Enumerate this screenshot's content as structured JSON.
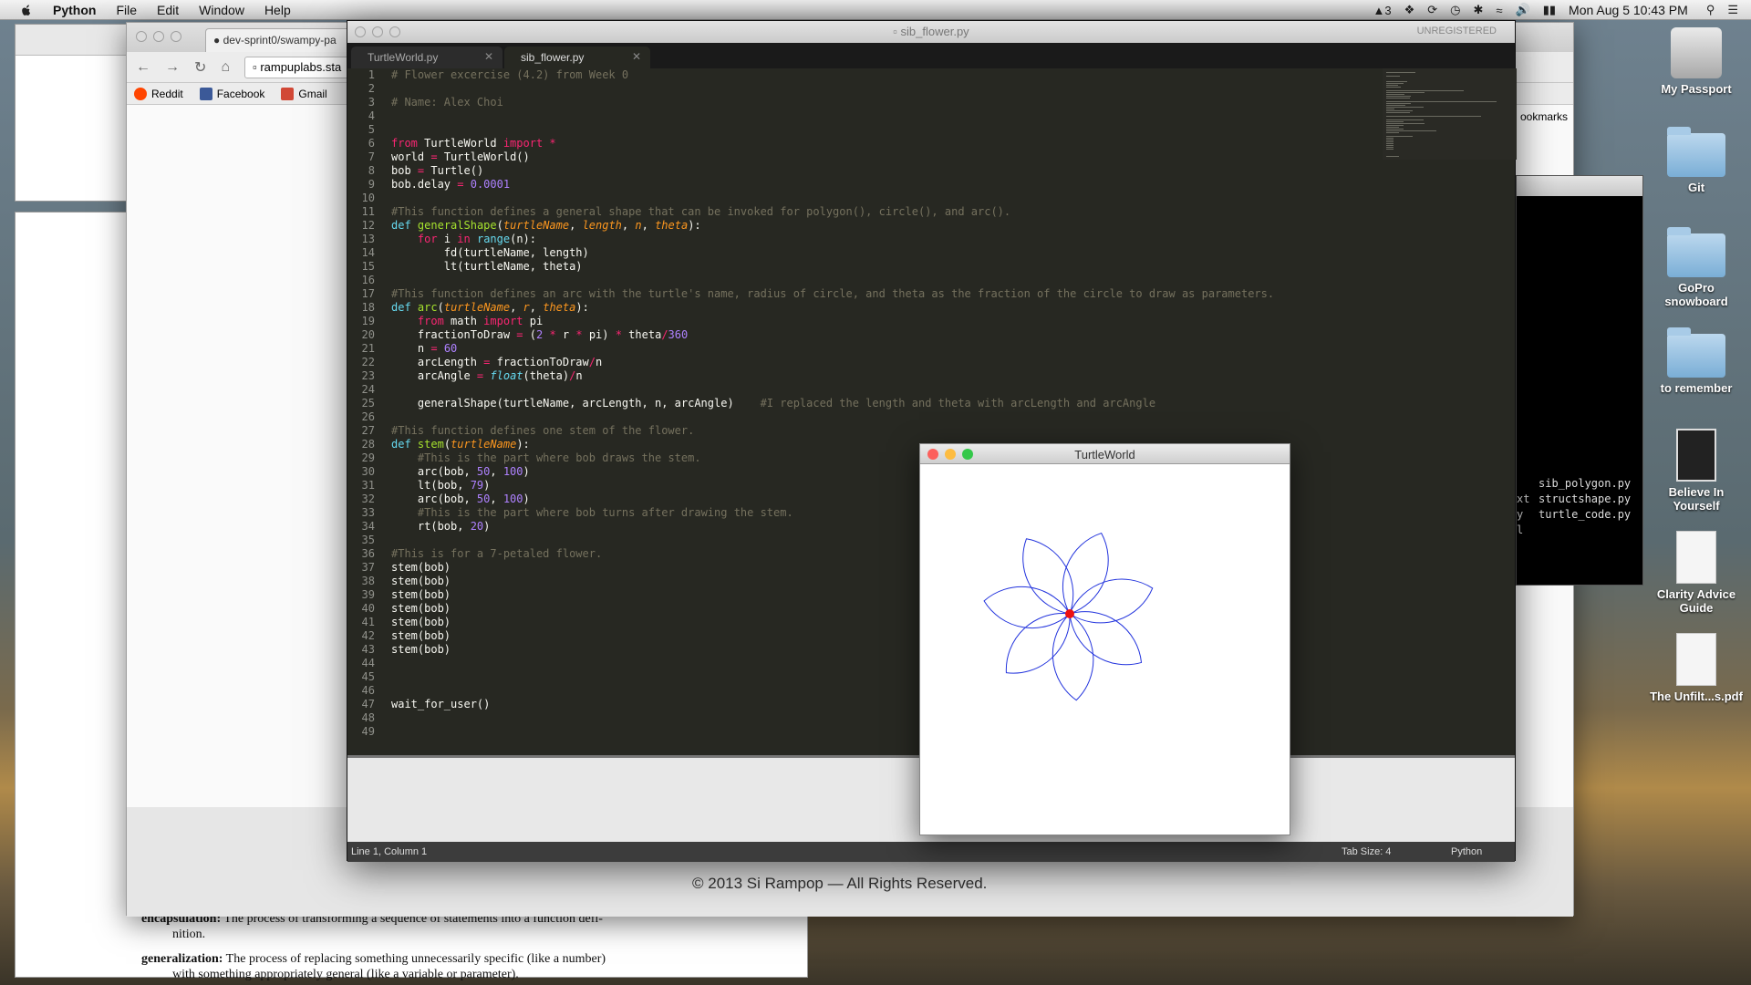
{
  "menubar": {
    "app_name": "Python",
    "items": [
      "File",
      "Edit",
      "Window",
      "Help"
    ],
    "status": {
      "notifications": "3",
      "clock": "Mon Aug 5  10:43 PM"
    }
  },
  "browser": {
    "tab_label": "dev-sprint0/swampy-pa",
    "url": "rampuplabs.sta",
    "bookmarks": [
      "Reddit",
      "Facebook",
      "Gmail"
    ],
    "bookmarks_overflow": "ookmarks",
    "copyright": "© 2013 Si Rampop — All Rights Reserved."
  },
  "pdf": {
    "glossary": [
      {
        "term": "encapsulation:",
        "text": "The process of transforming a sequence of statements into a function defi-",
        "cont": "nition."
      },
      {
        "term": "generalization:",
        "text": "The process of replacing something unnecessarily specific (like a number)",
        "cont": "with something appropriately general (like a variable or parameter)."
      }
    ]
  },
  "editor": {
    "window_title": "sib_flower.py",
    "registration": "UNREGISTERED",
    "tabs": [
      {
        "label": "TurtleWorld.py",
        "active": false
      },
      {
        "label": "sib_flower.py",
        "active": true
      }
    ],
    "status": {
      "position": "Line 1, Column 1",
      "tab_size": "Tab Size: 4",
      "syntax": "Python"
    },
    "lines": [
      [
        [
          "cm",
          "# Flower excercise (4.2) from Week 0"
        ]
      ],
      [],
      [
        [
          "cm",
          "# Name: Alex Choi"
        ]
      ],
      [],
      [],
      [
        [
          "kw",
          "from"
        ],
        [
          "t",
          " TurtleWorld "
        ],
        [
          "kw",
          "import"
        ],
        [
          "t",
          " "
        ],
        [
          "kw",
          "*"
        ]
      ],
      [
        [
          "t",
          "world "
        ],
        [
          "kw",
          "="
        ],
        [
          "t",
          " TurtleWorld()"
        ]
      ],
      [
        [
          "t",
          "bob "
        ],
        [
          "kw",
          "="
        ],
        [
          "t",
          " Turtle()"
        ]
      ],
      [
        [
          "t",
          "bob.delay "
        ],
        [
          "kw",
          "="
        ],
        [
          "t",
          " "
        ],
        [
          "num",
          "0.0001"
        ]
      ],
      [],
      [
        [
          "cm",
          "#This function defines a general shape that can be invoked for polygon(), circle(), and arc()."
        ]
      ],
      [
        [
          "bi",
          "def"
        ],
        [
          "t",
          " "
        ],
        [
          "fn",
          "generalShape"
        ],
        [
          "t",
          "("
        ],
        [
          "param",
          "turtleName"
        ],
        [
          "t",
          ", "
        ],
        [
          "param",
          "length"
        ],
        [
          "t",
          ", "
        ],
        [
          "param",
          "n"
        ],
        [
          "t",
          ", "
        ],
        [
          "param",
          "theta"
        ],
        [
          "t",
          "):"
        ]
      ],
      [
        [
          "t",
          "    "
        ],
        [
          "kw",
          "for"
        ],
        [
          "t",
          " i "
        ],
        [
          "kw",
          "in"
        ],
        [
          "t",
          " "
        ],
        [
          "bi",
          "range"
        ],
        [
          "t",
          "(n):"
        ]
      ],
      [
        [
          "t",
          "        fd(turtleName, length)"
        ]
      ],
      [
        [
          "t",
          "        lt(turtleName, theta)"
        ]
      ],
      [],
      [
        [
          "cm",
          "#This function defines an arc with the turtle's name, radius of circle, and theta as the fraction of the circle to draw as parameters."
        ]
      ],
      [
        [
          "bi",
          "def"
        ],
        [
          "t",
          " "
        ],
        [
          "fn",
          "arc"
        ],
        [
          "t",
          "("
        ],
        [
          "param",
          "turtleName"
        ],
        [
          "t",
          ", "
        ],
        [
          "param",
          "r"
        ],
        [
          "t",
          ", "
        ],
        [
          "param",
          "theta"
        ],
        [
          "t",
          "):"
        ]
      ],
      [
        [
          "t",
          "    "
        ],
        [
          "kw",
          "from"
        ],
        [
          "t",
          " math "
        ],
        [
          "kw",
          "import"
        ],
        [
          "t",
          " pi"
        ]
      ],
      [
        [
          "t",
          "    fractionToDraw "
        ],
        [
          "kw",
          "="
        ],
        [
          "t",
          " ("
        ],
        [
          "num",
          "2"
        ],
        [
          "t",
          " "
        ],
        [
          "kw",
          "*"
        ],
        [
          "t",
          " r "
        ],
        [
          "kw",
          "*"
        ],
        [
          "t",
          " pi) "
        ],
        [
          "kw",
          "*"
        ],
        [
          "t",
          " theta"
        ],
        [
          "kw",
          "/"
        ],
        [
          "num",
          "360"
        ]
      ],
      [
        [
          "t",
          "    n "
        ],
        [
          "kw",
          "="
        ],
        [
          "t",
          " "
        ],
        [
          "num",
          "60"
        ]
      ],
      [
        [
          "t",
          "    arcLength "
        ],
        [
          "kw",
          "="
        ],
        [
          "t",
          " fractionToDraw"
        ],
        [
          "kw",
          "/"
        ],
        [
          "t",
          "n"
        ]
      ],
      [
        [
          "t",
          "    arcAngle "
        ],
        [
          "kw",
          "="
        ],
        [
          "t",
          " "
        ],
        [
          "bii",
          "float"
        ],
        [
          "t",
          "(theta)"
        ],
        [
          "kw",
          "/"
        ],
        [
          "t",
          "n"
        ]
      ],
      [],
      [
        [
          "t",
          "    generalShape(turtleName, arcLength, n, arcAngle)    "
        ],
        [
          "cm",
          "#I replaced the length and theta with arcLength and arcAngle"
        ]
      ],
      [],
      [
        [
          "cm",
          "#This function defines one stem of the flower."
        ]
      ],
      [
        [
          "bi",
          "def"
        ],
        [
          "t",
          " "
        ],
        [
          "fn",
          "stem"
        ],
        [
          "t",
          "("
        ],
        [
          "param",
          "turtleName"
        ],
        [
          "t",
          "):"
        ]
      ],
      [
        [
          "t",
          "    "
        ],
        [
          "cm",
          "#This is the part where bob draws the stem."
        ]
      ],
      [
        [
          "t",
          "    arc(bob, "
        ],
        [
          "num",
          "50"
        ],
        [
          "t",
          ", "
        ],
        [
          "num",
          "100"
        ],
        [
          "t",
          ")"
        ]
      ],
      [
        [
          "t",
          "    lt(bob, "
        ],
        [
          "num",
          "79"
        ],
        [
          "t",
          ")"
        ]
      ],
      [
        [
          "t",
          "    arc(bob, "
        ],
        [
          "num",
          "50"
        ],
        [
          "t",
          ", "
        ],
        [
          "num",
          "100"
        ],
        [
          "t",
          ")"
        ]
      ],
      [
        [
          "t",
          "    "
        ],
        [
          "cm",
          "#This is the part where bob turns after drawing the stem."
        ]
      ],
      [
        [
          "t",
          "    rt(bob, "
        ],
        [
          "num",
          "20"
        ],
        [
          "t",
          ")"
        ]
      ],
      [],
      [
        [
          "cm",
          "#This is for a 7-petaled flower."
        ]
      ],
      [
        [
          "t",
          "stem(bob)"
        ]
      ],
      [
        [
          "t",
          "stem(bob)"
        ]
      ],
      [
        [
          "t",
          "stem(bob)"
        ]
      ],
      [
        [
          "t",
          "stem(bob)"
        ]
      ],
      [
        [
          "t",
          "stem(bob)"
        ]
      ],
      [
        [
          "t",
          "stem(bob)"
        ]
      ],
      [
        [
          "t",
          "stem(bob)"
        ]
      ],
      [],
      [],
      [],
      [
        [
          "t",
          "wait_for_user()"
        ]
      ],
      [],
      []
    ]
  },
  "terminal": {
    "files": [
      "sib_polygon.py",
      "structshape.py",
      "turtle_code.py"
    ],
    "partial": [
      "xt",
      "y",
      "l"
    ]
  },
  "turtle_window": {
    "title": "TurtleWorld",
    "petals": 7,
    "stroke_color": "#2233dd",
    "turtle_color": "#ee1111"
  },
  "desktop": {
    "icons": [
      {
        "label": "My Passport",
        "kind": "drive"
      },
      {
        "label": "Git",
        "kind": "folder"
      },
      {
        "label": "GoPro snowboard",
        "kind": "folder"
      },
      {
        "label": "to remember",
        "kind": "folder"
      },
      {
        "label": "Believe In Yourself",
        "kind": "book"
      },
      {
        "label": "Clarity Advice Guide",
        "kind": "doc"
      },
      {
        "label": "The Unfilt...s.pdf",
        "kind": "doc"
      }
    ]
  }
}
